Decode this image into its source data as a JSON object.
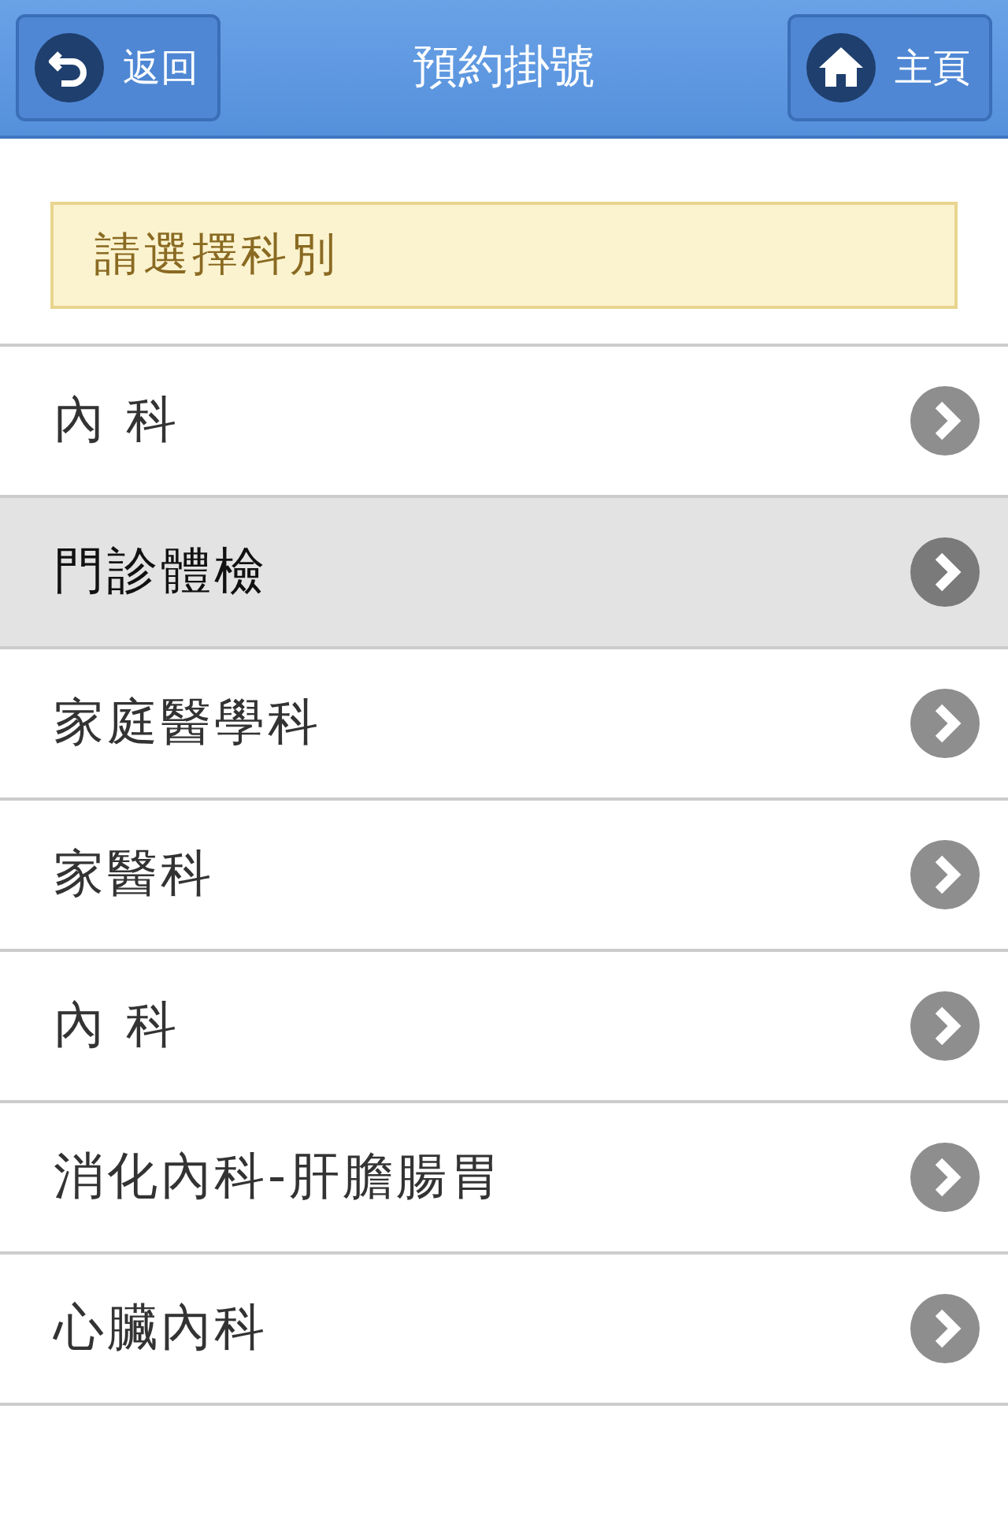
{
  "header": {
    "back_button": "返回",
    "title": "預約掛號",
    "home_button": "主頁"
  },
  "notice": "請選擇科別",
  "departments": [
    {
      "label": "內 科",
      "selected": false
    },
    {
      "label": "門診體檢",
      "selected": true
    },
    {
      "label": "家庭醫學科",
      "selected": false
    },
    {
      "label": "家醫科",
      "selected": false
    },
    {
      "label": "內 科",
      "selected": false
    },
    {
      "label": "消化內科-肝膽腸胃",
      "selected": false
    },
    {
      "label": "心臟內科",
      "selected": false
    }
  ]
}
